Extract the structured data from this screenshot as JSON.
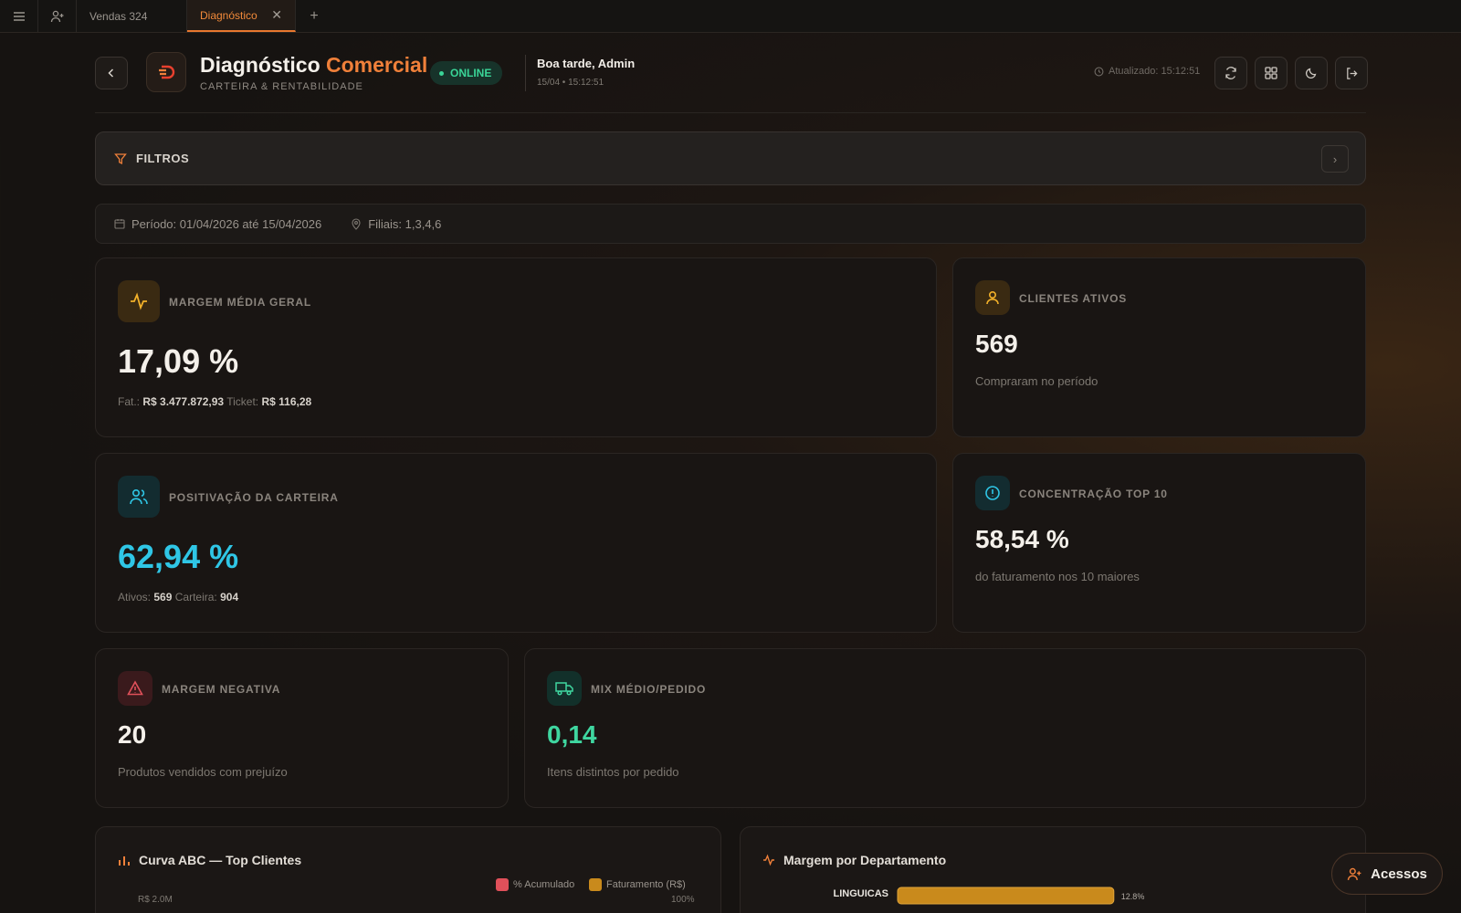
{
  "tabbar": {
    "tabs": [
      {
        "label": "Vendas 324",
        "active": false
      },
      {
        "label": "Diagnóstico",
        "active": true
      }
    ]
  },
  "header": {
    "title_main": "Diagnóstico",
    "title_accent": "Comercial",
    "subtitle": "CARTEIRA & RENTABILIDADE",
    "status": "ONLINE",
    "greeting": "Boa tarde, Admin",
    "datetime": "15/04 • 15:12:51",
    "updated": "Atualizado: 15:12:51"
  },
  "filters": {
    "label": "FILTROS"
  },
  "period": {
    "period_text": "Período: 01/04/2026 até 15/04/2026",
    "branches_text": "Filiais: 1,3,4,6"
  },
  "kpis": {
    "margem": {
      "label": "MARGEM MÉDIA GERAL",
      "value": "17,09 %",
      "fat_label": "Fat.:",
      "fat_value": "R$ 3.477.872,93",
      "ticket_label": "Ticket:",
      "ticket_value": "R$ 116,28"
    },
    "clientes": {
      "label": "CLIENTES ATIVOS",
      "value": "569",
      "sub": "Compraram no período"
    },
    "positivacao": {
      "label": "POSITIVAÇÃO DA CARTEIRA",
      "value": "62,94 %",
      "ativos_label": "Ativos:",
      "ativos_value": "569",
      "carteira_label": "Carteira:",
      "carteira_value": "904"
    },
    "concentracao": {
      "label": "CONCENTRAÇÃO TOP 10",
      "value": "58,54 %",
      "sub": "do faturamento nos 10 maiores"
    },
    "margem_negativa": {
      "label": "MARGEM NEGATIVA",
      "value": "20",
      "sub": "Produtos vendidos com prejuízo"
    },
    "mix": {
      "label": "MIX MÉDIO/PEDIDO",
      "value": "0,14",
      "sub": "Itens distintos por pedido"
    }
  },
  "panels": {
    "abc": {
      "title": "Curva ABC — Top Clientes",
      "legend_acumulado": "% Acumulado",
      "legend_faturamento": "Faturamento (R$)",
      "y_left_top": "R$ 2.0M",
      "y_right_top": "100%"
    },
    "margem_depto": {
      "title": "Margem por Departamento"
    }
  },
  "chart_data": {
    "type": "bar",
    "title": "Margem por Departamento",
    "categories": [
      "LINGUICAS"
    ],
    "values": [
      12.8
    ],
    "value_labels": [
      "12.8%"
    ]
  },
  "fab": {
    "label": "Acessos"
  },
  "colors": {
    "accent": "#f0803a",
    "online": "#3ad497",
    "positivacao": "#2fc6e6",
    "mix": "#3fd6a0",
    "danger": "#e0505a",
    "bar_gold": "#c98a1c",
    "bar_green": "#1fa57a"
  }
}
